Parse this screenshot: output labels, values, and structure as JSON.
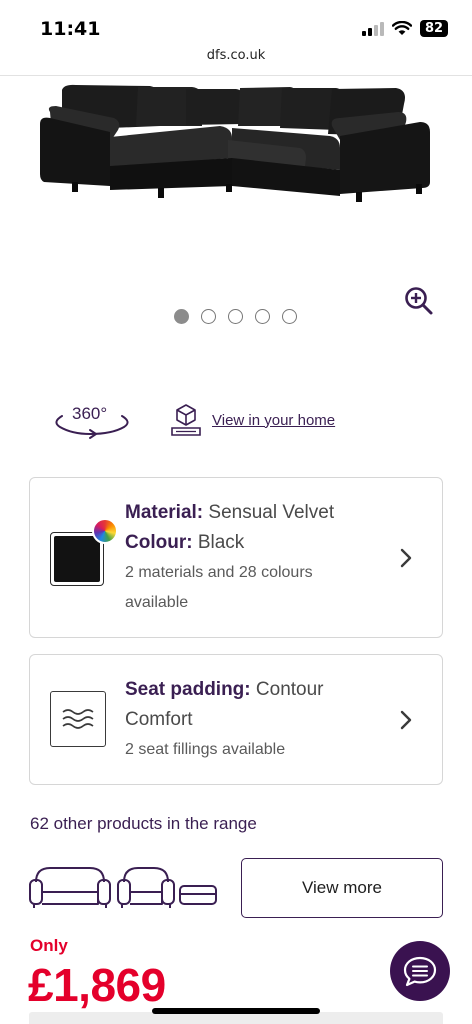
{
  "status_bar": {
    "time": "11:41",
    "battery": "82"
  },
  "browser": {
    "url": "dfs.co.uk"
  },
  "carousel": {
    "slide_count": 5,
    "active_index": 0
  },
  "media_actions": {
    "view360_label": "360°",
    "ar_label": "View in your home"
  },
  "material_card": {
    "material_label": "Material:",
    "material_value": "Sensual Velvet",
    "colour_label": "Colour:",
    "colour_value": "Black",
    "availability_line1": "2 materials and 28 colours",
    "availability_line2": "available"
  },
  "padding_card": {
    "label": "Seat padding:",
    "value_line1": "Contour",
    "value_line2": "Comfort",
    "availability": "2 seat fillings available"
  },
  "range": {
    "text": "62 other products in the range",
    "view_more_label": "View more"
  },
  "pricing": {
    "prefix": "Only",
    "price": "£1,869"
  },
  "colors": {
    "brand": "#3a1f52",
    "price_red": "#e4002b",
    "chat_bg": "#3a1250"
  }
}
